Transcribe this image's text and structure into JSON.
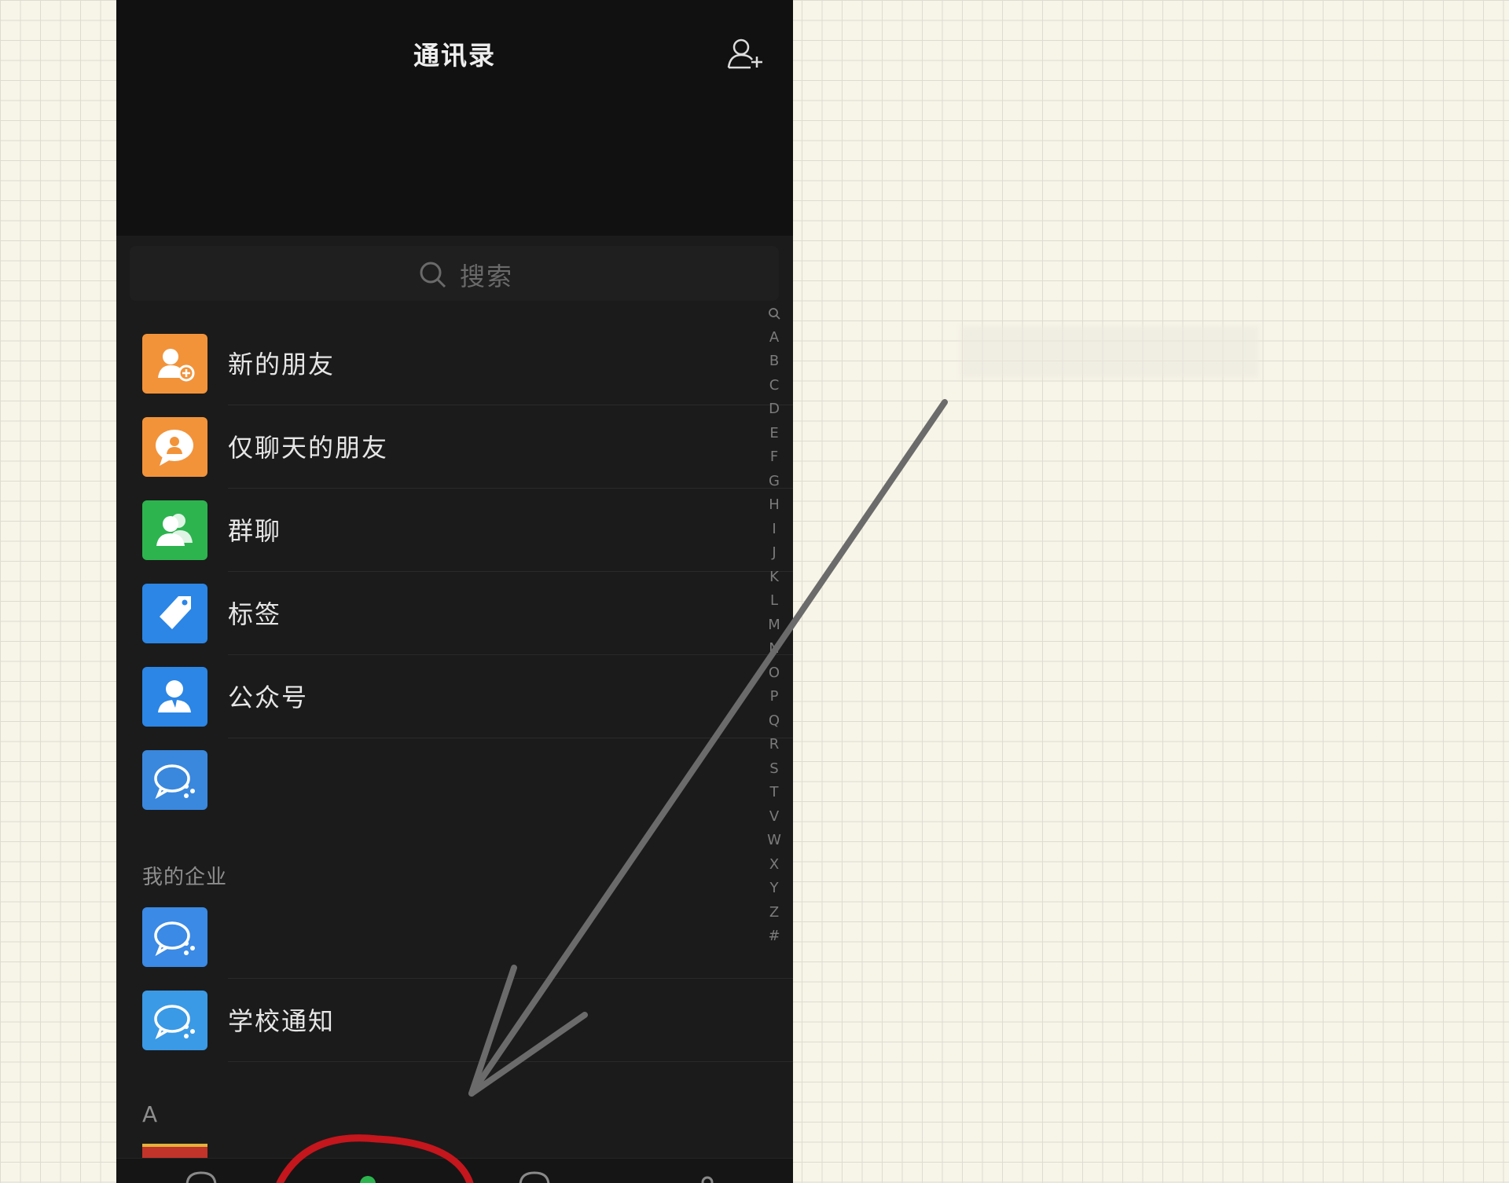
{
  "header": {
    "title": "通讯录"
  },
  "search": {
    "placeholder": "搜索"
  },
  "contacts_top": [
    {
      "label": "新的朋友",
      "icon": "new-friend-icon",
      "color": "#f2933a"
    },
    {
      "label": "仅聊天的朋友",
      "icon": "chat-only-friend-icon",
      "color": "#f2933a"
    },
    {
      "label": "群聊",
      "icon": "group-chat-icon",
      "color": "#2db44f"
    },
    {
      "label": "标签",
      "icon": "tag-icon",
      "color": "#2b86e6"
    },
    {
      "label": "公众号",
      "icon": "official-account-icon",
      "color": "#2b86e6"
    },
    {
      "label": "",
      "icon": "enterprise-chat-icon",
      "color": "#3a88de"
    }
  ],
  "enterprise": {
    "header": "我的企业",
    "items": [
      {
        "label": "",
        "icon": "enterprise-chat-icon",
        "color": "#3a8ae6"
      },
      {
        "label": "学校通知",
        "icon": "enterprise-chat-icon",
        "color": "#3a9ae6"
      }
    ]
  },
  "section_a": {
    "header": "A"
  },
  "index": [
    "A",
    "B",
    "C",
    "D",
    "E",
    "F",
    "G",
    "H",
    "I",
    "J",
    "K",
    "L",
    "M",
    "N",
    "O",
    "P",
    "Q",
    "R",
    "S",
    "T",
    "V",
    "W",
    "X",
    "Y",
    "Z",
    "#"
  ],
  "colors": {
    "background": "#f7f5e8",
    "phone_bg": "#1b1b1b",
    "annotation_arrow": "#6b6b6b",
    "annotation_circle": "#c4161c",
    "active_tab": "#2db44f"
  }
}
